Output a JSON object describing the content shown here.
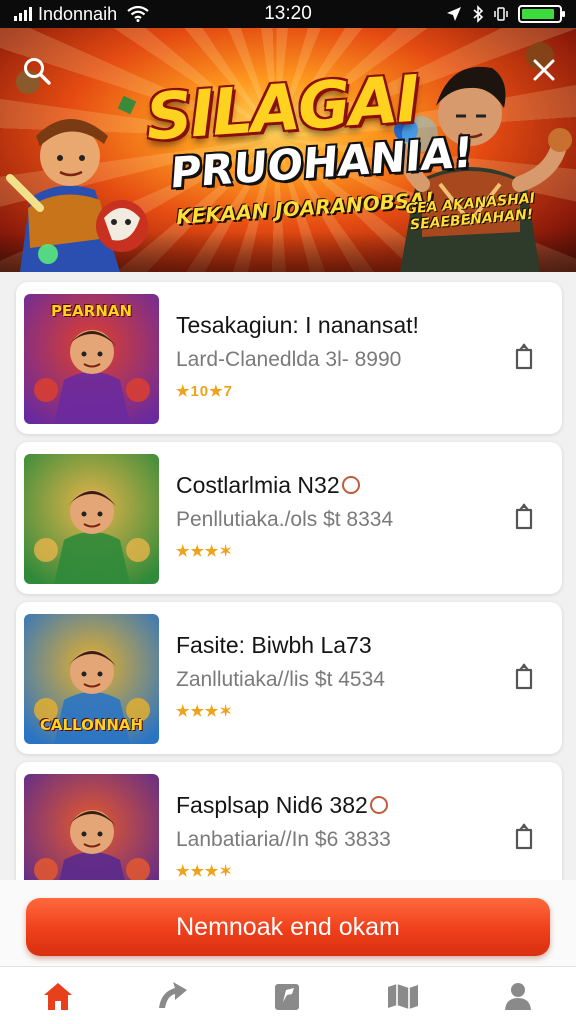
{
  "status_bar": {
    "carrier": "Indonnaih",
    "time": "13:20",
    "battery_level": 0.9
  },
  "hero": {
    "title": "SILAGAI",
    "subtitle": "PRUOHANIA!",
    "tagline": "KEKAAN JOARANOBSA!",
    "tagline2": "GEA AKANASHAI SEAEBENAHAN!"
  },
  "games": [
    {
      "title": "Tesakagiun: I nanansat!",
      "title_badge": false,
      "meta": "Lard-Clanedlda 3l- 8990",
      "rating_text": "★10★7",
      "thumb_label": "PEARNAN",
      "thumb_colors": [
        "#6a2a9e",
        "#e0402a"
      ]
    },
    {
      "title": "Costlarlmia N32",
      "title_badge": true,
      "meta": "Penllutiaka./ols $t 8334",
      "rating_text": "★★★✶",
      "thumb_label": "",
      "thumb_colors": [
        "#2f8a3a",
        "#e8b44a"
      ]
    },
    {
      "title": "Fasite: Biwbh La73",
      "title_badge": false,
      "meta": "Zanllutiaka//lis $t 4534",
      "rating_text": "★★★✶",
      "thumb_label": "CALLONNAH",
      "thumb_colors": [
        "#2a74c4",
        "#e8b02a"
      ]
    },
    {
      "title": "Fasplsap Nid6 382",
      "title_badge": true,
      "meta": "Lanbatiaria//In $6 3833",
      "rating_text": "★★★✶",
      "thumb_label": "",
      "thumb_colors": [
        "#5a2a8e",
        "#e85a2a"
      ]
    }
  ],
  "cta": {
    "label": "Nemnoak end okam"
  },
  "tabs": [
    {
      "name": "home",
      "active": true
    },
    {
      "name": "explore",
      "active": false
    },
    {
      "name": "library",
      "active": false
    },
    {
      "name": "map",
      "active": false
    },
    {
      "name": "profile",
      "active": false
    }
  ],
  "colors": {
    "accent": "#ef3f1b",
    "rating": "#f0a21a",
    "meta": "#7a7a7a"
  }
}
